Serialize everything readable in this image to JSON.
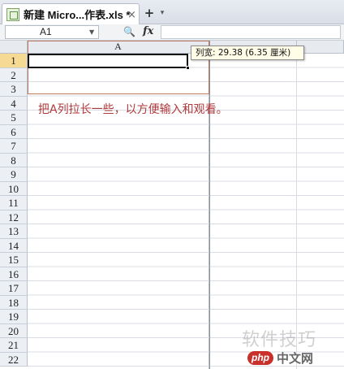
{
  "tab": {
    "title": "新建 Micro...作表.xls *",
    "close_glyph": "×",
    "new_tab_glyph": "+",
    "new_tab_dropdown_glyph": "▾"
  },
  "formula_bar": {
    "cell_ref": "A1",
    "fx_label": "fx",
    "zoom_glyph": "🔍",
    "formula_value": ""
  },
  "columns": [
    "A"
  ],
  "rows": [
    "1",
    "2",
    "3",
    "4",
    "5",
    "6",
    "7",
    "8",
    "9",
    "10",
    "11",
    "12",
    "13",
    "14",
    "15",
    "16",
    "17",
    "18",
    "19",
    "20",
    "21",
    "22"
  ],
  "active_row": "1",
  "tooltip": "列宽: 29.38 (6.35 厘米)",
  "annotation": "把A列拉长一些，以方便输入和观看。",
  "watermark": {
    "text": "软件技巧",
    "badge": "php",
    "site": "中文网"
  },
  "colors": {
    "annotation": "#b0393c",
    "active_row_header": "#f6d992",
    "column_highlight_border": "#c07a62"
  }
}
